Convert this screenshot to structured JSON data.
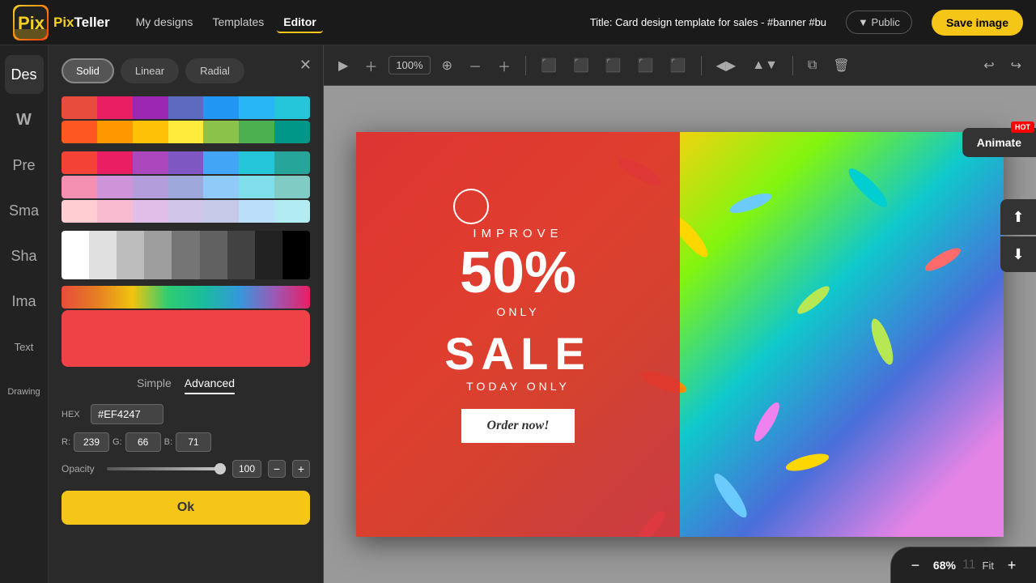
{
  "logo": {
    "icon_text": "Pix",
    "name": "PixTeller"
  },
  "nav": {
    "links": [
      {
        "label": "My designs",
        "id": "my-designs",
        "active": false
      },
      {
        "label": "Templates",
        "id": "templates",
        "active": false
      },
      {
        "label": "Editor",
        "id": "editor",
        "active": true
      }
    ],
    "title_prefix": "Title:",
    "title_value": "Card design template for sales - #banner #bu",
    "public_label": "▼ Public",
    "save_label": "Save image"
  },
  "sidebar": {
    "items": [
      {
        "label": "Des",
        "icon": "🎨",
        "id": "design"
      },
      {
        "label": "W",
        "icon": "W",
        "id": "text-w"
      },
      {
        "label": "Pre",
        "icon": "📋",
        "id": "presets"
      },
      {
        "label": "Sma",
        "icon": "⚡",
        "id": "smart"
      },
      {
        "label": "Sha",
        "icon": "◻",
        "id": "shapes"
      },
      {
        "label": "Ima",
        "icon": "🖼",
        "id": "images"
      },
      {
        "label": "Text",
        "icon": "T",
        "id": "text"
      },
      {
        "label": "Drawing",
        "icon": "✏️",
        "id": "drawing"
      }
    ]
  },
  "color_panel": {
    "type_tabs": [
      {
        "label": "Solid",
        "active": true
      },
      {
        "label": "Linear",
        "active": false
      },
      {
        "label": "Radial",
        "active": false
      }
    ],
    "close_label": "✕",
    "swatches": {
      "row1": [
        "#e74c3c",
        "#e91e63",
        "#9c27b0",
        "#3f51b5",
        "#2196f3",
        "#03a9f4",
        "#00bcd4"
      ],
      "row2": [
        "#ff5722",
        "#ff9800",
        "#ffc107",
        "#ffeb3b",
        "#8bc34a",
        "#4caf50",
        "#009688"
      ],
      "row3a": [
        "#f44336",
        "#e91e63",
        "#9c27b0",
        "#673ab7",
        "#3f51b5",
        "#2196f3",
        "#03bcd4"
      ],
      "row3b": [
        "#f48fb1",
        "#ce93d8",
        "#b39ddb",
        "#9fa8da",
        "#90caf9",
        "#80deea",
        "#80cbc4"
      ],
      "row3c": [
        "#ffcdd2",
        "#f8bbd0",
        "#e1bee7",
        "#d1c4e9",
        "#c5cae9",
        "#bbdefb",
        "#b2ebf2"
      ],
      "row4": [
        "#fff",
        "#eee",
        "#ccc",
        "#aaa",
        "#888",
        "#666",
        "#444",
        "#333",
        "#222",
        "#000"
      ]
    },
    "current_color": "#EF4247",
    "mode_tabs": [
      {
        "label": "Simple",
        "active": false
      },
      {
        "label": "Advanced",
        "active": true
      }
    ],
    "hex_label": "HEX",
    "hex_value": "#EF4247",
    "r_label": "R:",
    "r_value": "239",
    "g_label": "G:",
    "g_value": "66",
    "b_label": "B:",
    "b_value": "71",
    "opacity_label": "Opacity",
    "opacity_value": "100",
    "opacity_minus": "−",
    "opacity_plus": "+",
    "ok_label": "Ok"
  },
  "toolbar": {
    "zoom_value": "100%",
    "undo_label": "↩",
    "redo_label": "↪"
  },
  "canvas": {
    "improve_label": "IMPROVE",
    "percent_label": "50%",
    "only_label": "ONLY",
    "sale_label": "SALE",
    "today_label": "TODAY ONLY",
    "order_label": "Order now!"
  },
  "animate_btn": {
    "label": "Animate",
    "hot_badge": "HOT"
  },
  "zoom_bar": {
    "minus": "−",
    "value": "68%",
    "separator": "11",
    "fit": "Fit",
    "plus": "+"
  }
}
